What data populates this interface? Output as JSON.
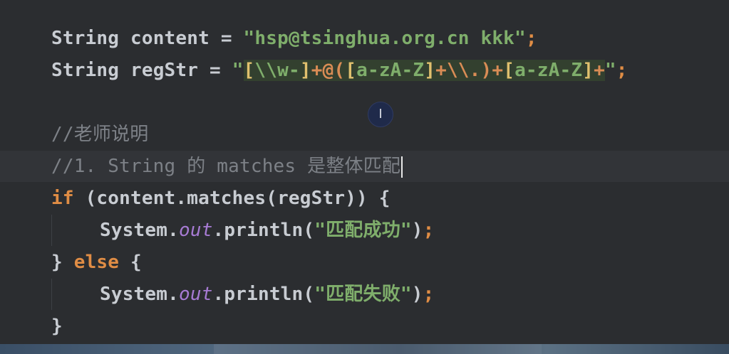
{
  "code": {
    "line1": {
      "type": "String",
      "name": "content",
      "eq": "=",
      "value": "\"hsp@tsinghua.org.cn kkk\"",
      "semi": ";"
    },
    "line2": {
      "type": "String",
      "name": "regStr",
      "eq": "=",
      "quote_open": "\"",
      "rx": {
        "b1": "[",
        "t1": "\\\\w-",
        "b2": "]",
        "op1": "+@(",
        "b3": "[",
        "t2": "a-zA-Z",
        "b4": "]",
        "op2": "+\\\\.)+",
        "b5": "[",
        "t3": "a-zA-Z",
        "b6": "]",
        "op3": "+"
      },
      "quote_close": "\"",
      "semi": ";"
    },
    "comment1": "//老师说明",
    "comment2": "//1. String 的 matches 是整体匹配",
    "if_kw": "if",
    "if_rest": " (content.matches(regStr)) {",
    "println1": {
      "obj": "System.",
      "field": "out",
      "call": ".println(",
      "arg": "\"匹配成功\"",
      "close": ")",
      "semi": ";"
    },
    "else_open": "} ",
    "else_kw": "else",
    "else_rest": " {",
    "println2": {
      "obj": "System.",
      "field": "out",
      "call": ".println(",
      "arg": "\"匹配失败\"",
      "close": ")",
      "semi": ";"
    },
    "close_brace": "}"
  },
  "cursor": {
    "glyph": "I",
    "icon": "text-cursor-icon"
  },
  "colors": {
    "background": "#2b2d30",
    "keyword": "#e08d45",
    "string": "#7fae6b",
    "comment": "#7d8187",
    "field": "#a77bd4",
    "regex_bracket": "#e0c06e",
    "regex_highlight": "#33402f"
  }
}
